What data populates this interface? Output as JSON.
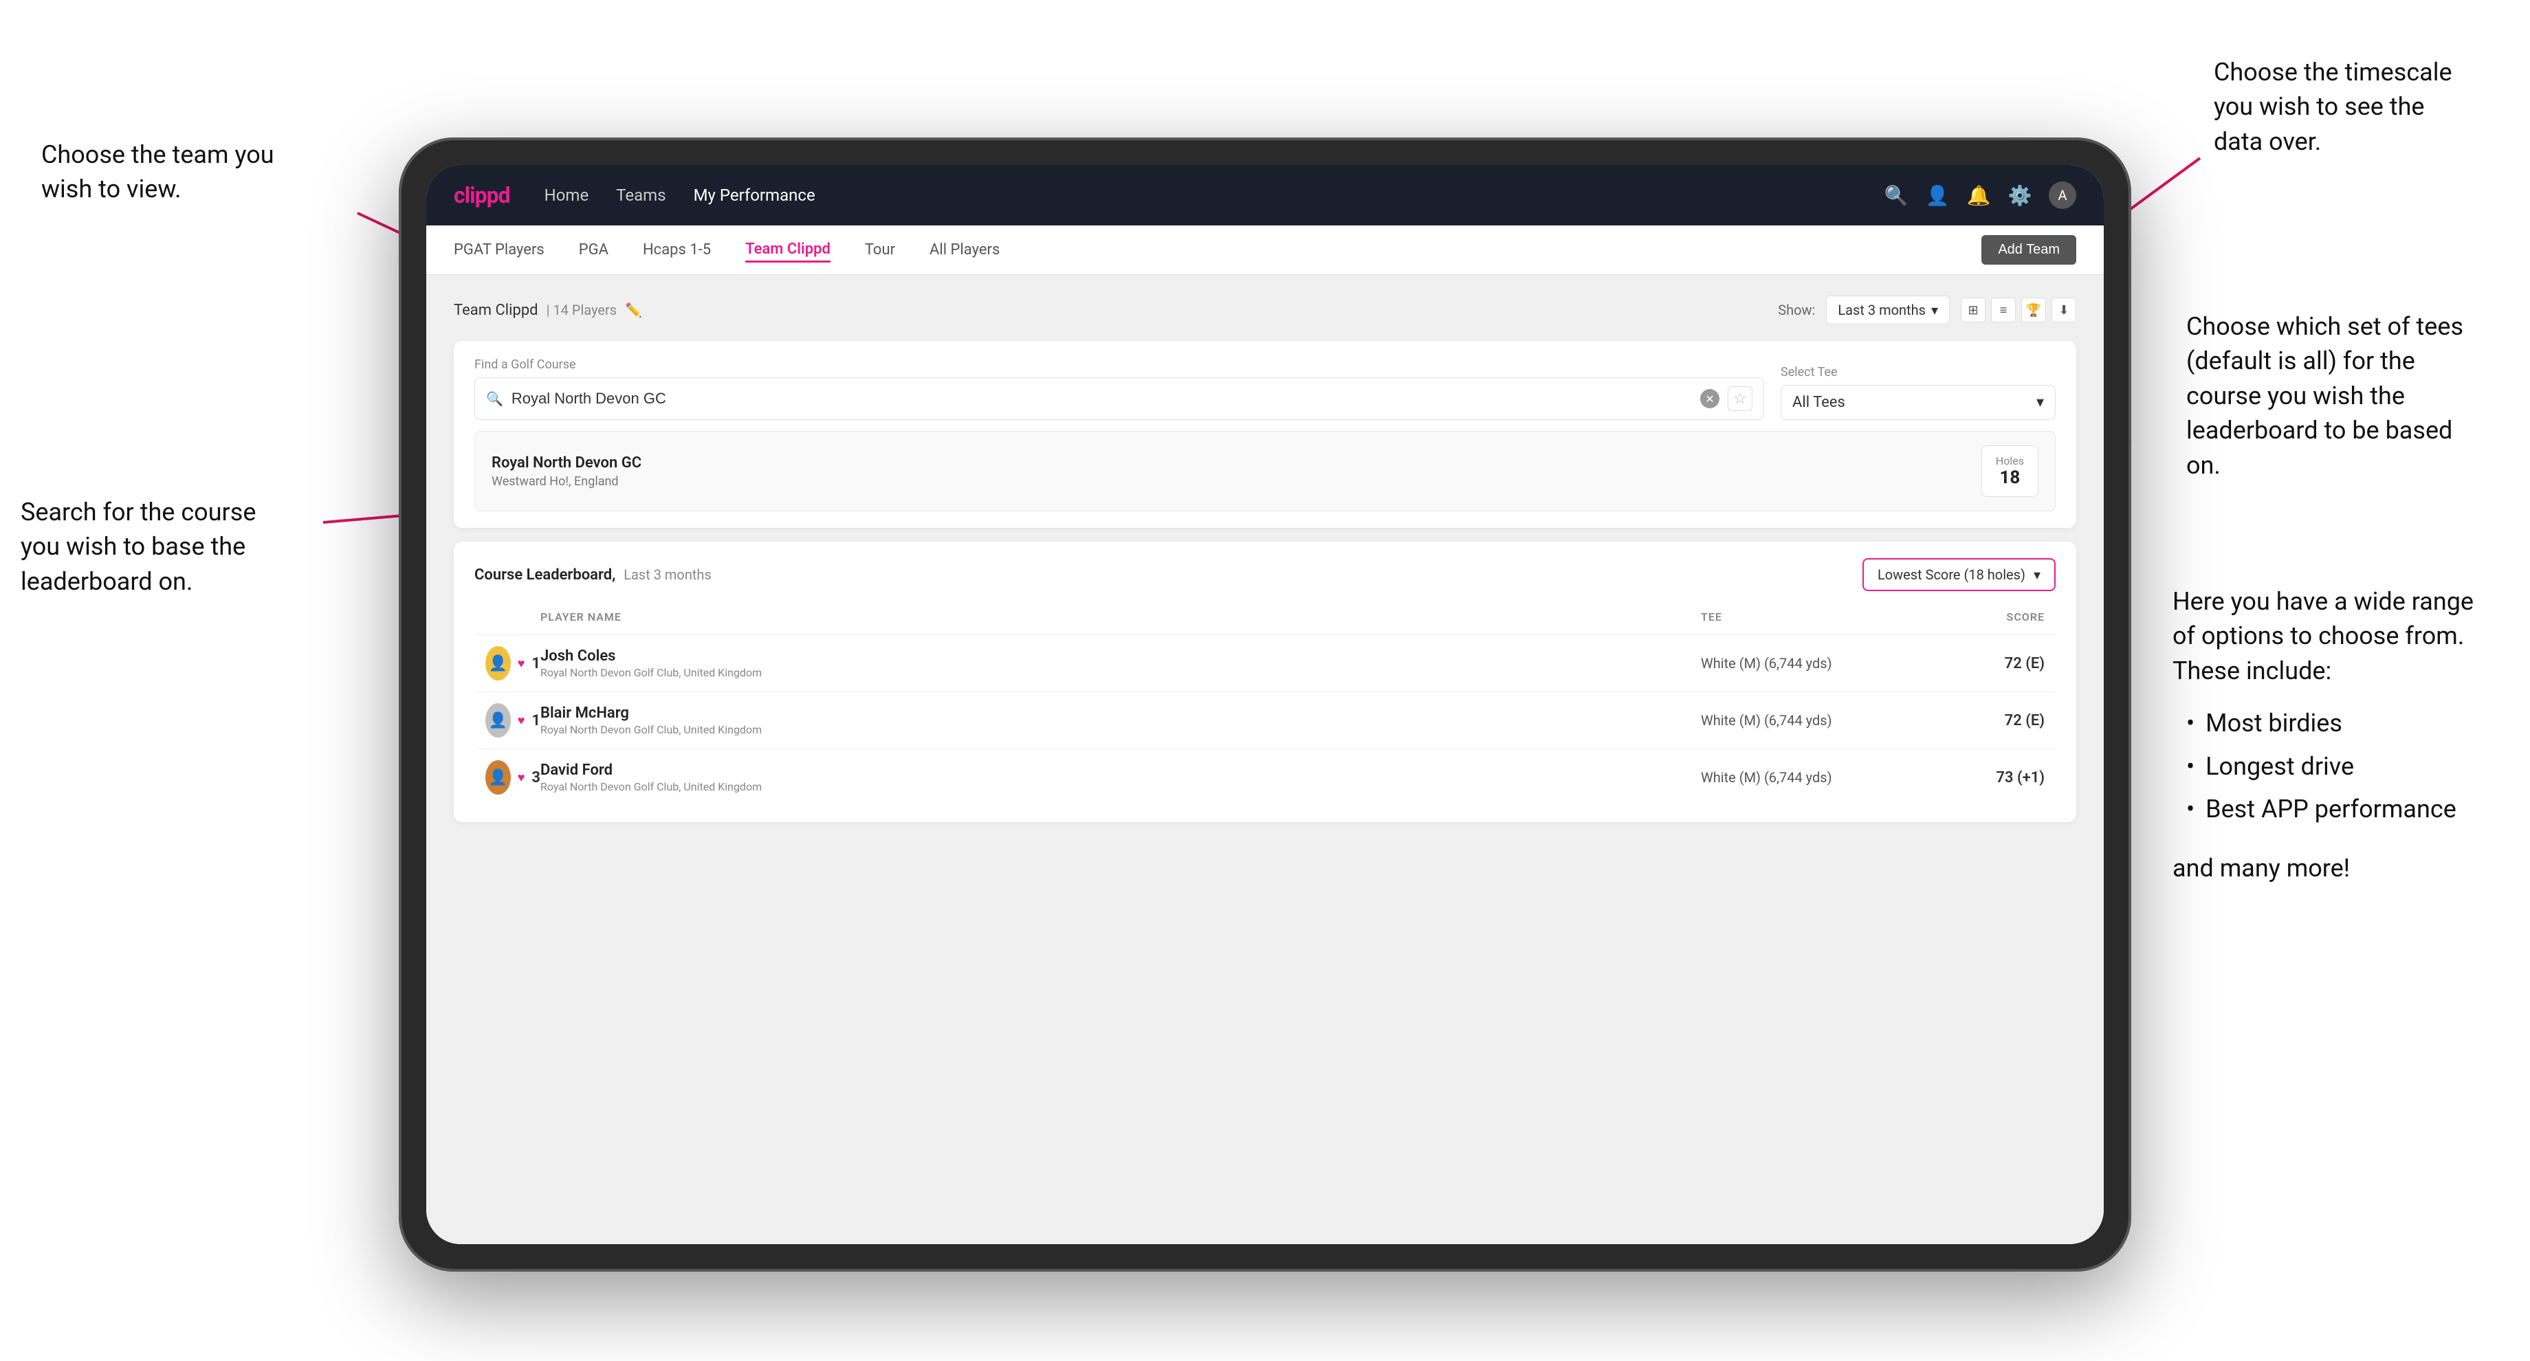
{
  "annotations": {
    "top_left": {
      "title": "Choose the team you wish to view.",
      "top": "Choose the timescale you wish to see the data over.",
      "middle_left": "Search for the course you wish to base the leaderboard on.",
      "right_side": "Choose which set of tees (default is all) for the course you wish the leaderboard to be based on.",
      "score_options_title": "Here you have a wide range of options to choose from. These include:",
      "options": [
        "Most birdies",
        "Longest drive",
        "Best APP performance"
      ],
      "and_more": "and many more!"
    }
  },
  "navbar": {
    "brand": "clippd",
    "links": [
      "Home",
      "Teams",
      "My Performance"
    ],
    "active_link": "My Performance",
    "icons": [
      "search",
      "person",
      "bell",
      "settings",
      "user"
    ]
  },
  "sub_navbar": {
    "links": [
      "PGAT Players",
      "PGA",
      "Hcaps 1-5",
      "Team Clippd",
      "Tour",
      "All Players"
    ],
    "active_link": "Team Clippd",
    "add_team_label": "Add Team"
  },
  "team_header": {
    "title": "Team Clippd",
    "player_count": "14 Players",
    "show_label": "Show:",
    "time_period": "Last 3 months"
  },
  "search_section": {
    "find_course_label": "Find a Golf Course",
    "course_value": "Royal North Devon GC",
    "select_tee_label": "Select Tee",
    "tee_value": "All Tees"
  },
  "course_result": {
    "name": "Royal North Devon GC",
    "location": "Westward Ho!, England",
    "holes_label": "Holes",
    "holes_value": "18"
  },
  "leaderboard": {
    "title": "Course Leaderboard,",
    "subtitle": "Last 3 months",
    "score_filter": "Lowest Score (18 holes)",
    "columns": {
      "player_name": "PLAYER NAME",
      "tee": "TEE",
      "score": "SCORE"
    },
    "rows": [
      {
        "rank": 1,
        "name": "Josh Coles",
        "club": "Royal North Devon Golf Club, United Kingdom",
        "tee": "White (M) (6,744 yds)",
        "score": "72 (E)"
      },
      {
        "rank": 1,
        "name": "Blair McHarg",
        "club": "Royal North Devon Golf Club, United Kingdom",
        "tee": "White (M) (6,744 yds)",
        "score": "72 (E)"
      },
      {
        "rank": 3,
        "name": "David Ford",
        "club": "Royal North Devon Golf Club, United Kingdom",
        "tee": "White (M) (6,744 yds)",
        "score": "73 (+1)"
      }
    ]
  },
  "side_notes": {
    "options_title": "Here you have a wide range of options to choose from. These include:",
    "option1": "Most birdies",
    "option2": "Longest drive",
    "option3": "Best APP performance",
    "and_more": "and many more!"
  }
}
